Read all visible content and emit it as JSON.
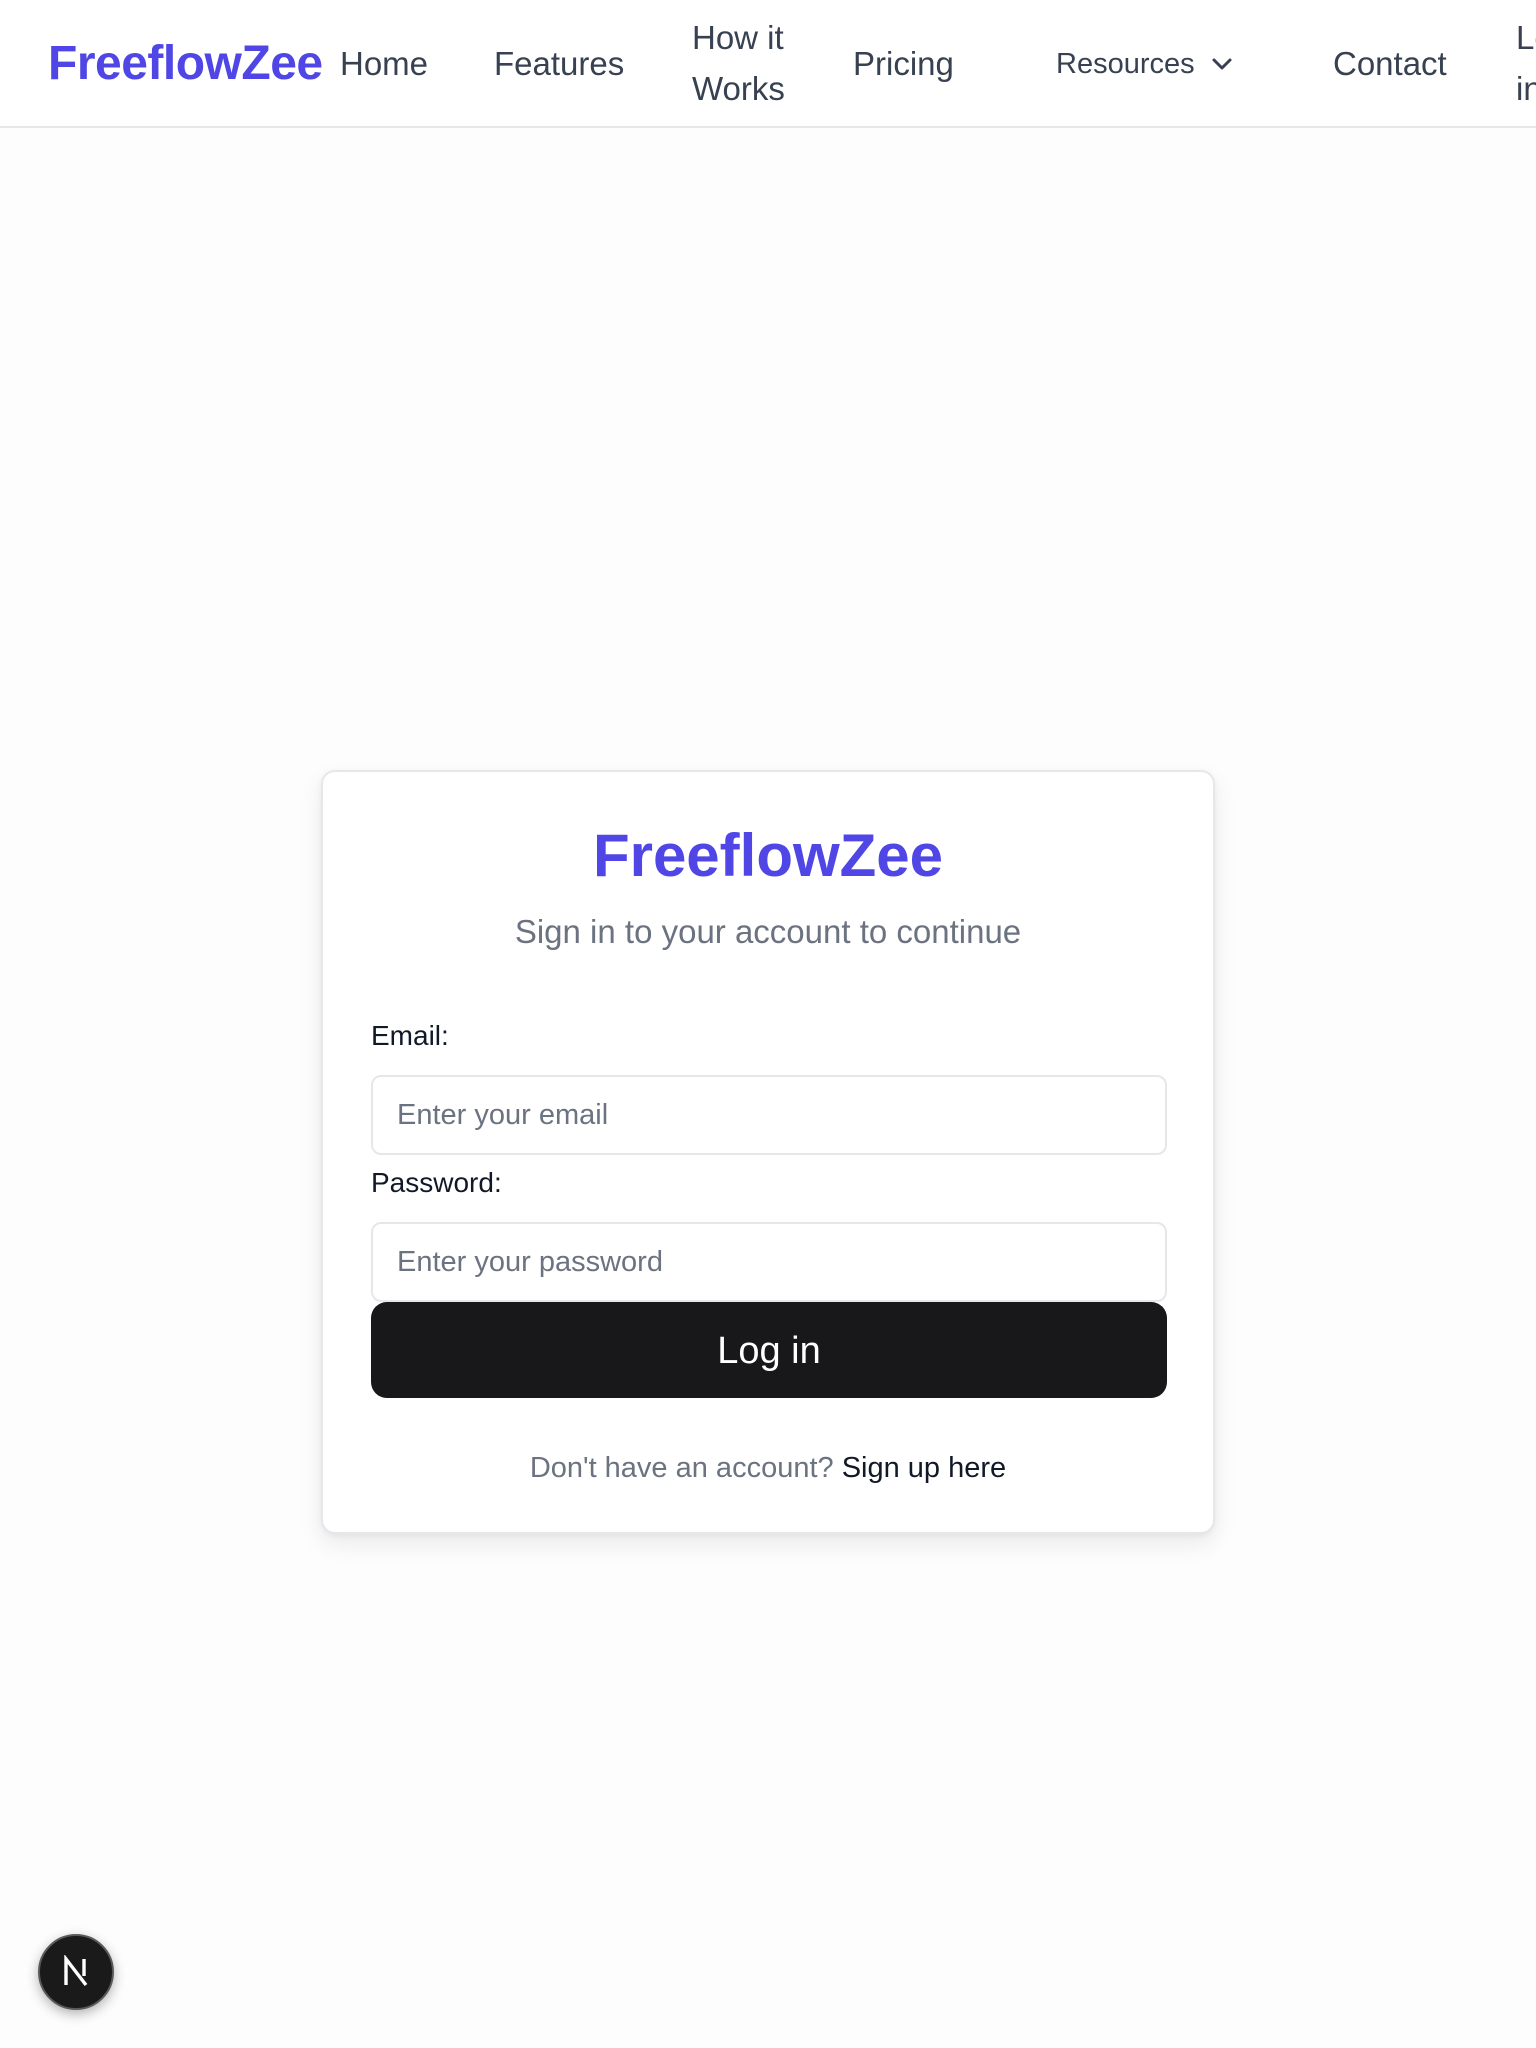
{
  "nav": {
    "brand": "FreeflowZee",
    "items": {
      "home": "Home",
      "features": "Features",
      "how_it_works": "How it Works",
      "pricing": "Pricing",
      "resources": "Resources",
      "contact": "Contact",
      "login": "Log in"
    }
  },
  "login_card": {
    "title": "FreeflowZee",
    "subtitle": "Sign in to your account to continue",
    "email_label": "Email:",
    "email_placeholder": "Enter your email",
    "email_value": "",
    "password_label": "Password:",
    "password_placeholder": "Enter your password",
    "password_value": "",
    "submit_label": "Log in",
    "signup_prompt": "Don't have an account?",
    "signup_link": "Sign up here"
  },
  "dev_badge": {
    "letter": "N",
    "icon": "nextjs-logo-icon"
  },
  "colors": {
    "brand": "#4f46e5",
    "button": "#18181b",
    "muted_text": "#6b7280"
  }
}
